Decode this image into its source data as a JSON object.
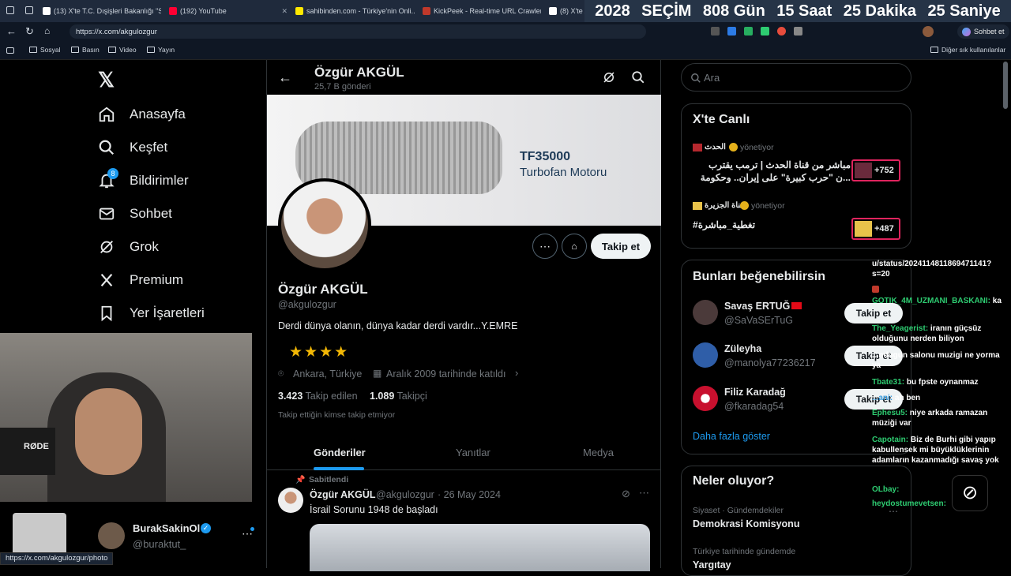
{
  "tabs": [
    {
      "label": "(13) X'te T.C. Dışişleri Bakanlığı \"S...",
      "color": "#fff"
    },
    {
      "label": "(192) YouTube",
      "color": "#ff0033"
    },
    {
      "label": "sahibinden.com - Türkiye'nin Onli...",
      "color": "#ffe800"
    },
    {
      "label": "KickPeek - Real-time URL Crawler...",
      "color": "#c0392b"
    },
    {
      "label": "(8) X'te A...",
      "color": "#fff"
    }
  ],
  "banner": {
    "year": "2028",
    "election": "SEÇİM",
    "days": "808 Gün",
    "hours": "15 Saat",
    "minutes": "25 Dakika",
    "seconds": "25 Saniye"
  },
  "address": {
    "url": "https://x.com/akgulozgur",
    "chat_button": "Sohbet et"
  },
  "bookmarks": {
    "items": [
      "Sosyal",
      "Basın",
      "Video",
      "Yayın"
    ],
    "other": "Diğer sık kullanılanlar"
  },
  "nav": {
    "home": "Anasayfa",
    "explore": "Keşfet",
    "notifications": "Bildirimler",
    "notif_count": "8",
    "messages": "Sohbet",
    "grok": "Grok",
    "premium": "Premium",
    "bookmarks": "Yer İşaretleri"
  },
  "account": {
    "name": "BurakSakinOl",
    "handle": "@buraktut_"
  },
  "status_url": "https://x.com/akgulozgur/photo",
  "profile": {
    "header_name": "Özgür AKGÜL",
    "post_count": "25,7 B gönderi",
    "banner_title": "TF35000",
    "banner_subtitle": "Turbofan Motoru",
    "name": "Özgür AKGÜL",
    "handle": "@akgulozgur",
    "bio": "Derdi dünya olanın, dünya kadar derdi vardır...Y.EMRE",
    "stars": "★★★★",
    "location": "Ankara, Türkiye",
    "joined": "Aralık 2009 tarihinde katıldı",
    "following_count": "3.423",
    "following_label": "Takip edilen",
    "followers_count": "1.089",
    "followers_label": "Takipçi",
    "no_mutual": "Takip ettiğin kimse takip etmiyor",
    "follow_button": "Takip et"
  },
  "tabs_profile": [
    "Gönderiler",
    "Yanıtlar",
    "Medya"
  ],
  "post": {
    "pinned": "Sabitlendi",
    "name": "Özgür AKGÜL",
    "handle": "@akgulozgur",
    "date": "· 26 May 2024",
    "text": "İsrail Sorunu 1948 de başladı"
  },
  "search": {
    "placeholder": "Ara"
  },
  "live": {
    "title": "X'te Canlı",
    "items": [
      {
        "source": "الحدث",
        "role": "yönetiyor",
        "text1": "مباشر من قناة الحدث | ترمب يقترب",
        "text2": "...ن \"حرب كبيرة\" على إيران.. وحكومة",
        "count": "+752"
      },
      {
        "source": "قناة الجزيرة",
        "role": "yönetiyor",
        "text1": "#تغطية_مباشرة",
        "text2": "",
        "count": "+487"
      }
    ]
  },
  "suggest": {
    "title": "Bunları beğenebilirsin",
    "people": [
      {
        "name": "Savaş ERTUĞ",
        "handle": "@SaVaSErTuG",
        "button": "Takip et"
      },
      {
        "name": "Züleyha",
        "handle": "@manolya77236217",
        "button": "Takip et"
      },
      {
        "name": "Filiz Karadağ",
        "handle": "@fkaradag54",
        "button": "Takip et"
      }
    ],
    "more": "Daha fazla göster"
  },
  "trends": {
    "title": "Neler oluyor?",
    "items": [
      {
        "meta": "Siyaset · Gündemdekiler",
        "topic": "Demokrasi Komisyonu"
      },
      {
        "meta": "Türkiye tarihinde gündemde",
        "topic": "Yargıtay"
      }
    ]
  },
  "chat": [
    {
      "user": "",
      "text": "u/status/2024114811869471141?s=20",
      "color": "#fff"
    },
    {
      "user": "GOTIK_4M_UZMANI_BASKANI:",
      "text": " ka",
      "color": "#2ecc71"
    },
    {
      "user": "The_Yeagerist:",
      "text": " iranın güçsüz olduğunu nerden biliyon",
      "color": "#2ecc71"
    },
    {
      "user": "",
      "text": "...ndugun salonu muzigi ne yorma ya",
      "color": "#fff"
    },
    {
      "user": "Tbate31:",
      "text": " bu fpste oynanmaz",
      "color": "#2ecc71"
    },
    {
      "user": "...ani:",
      "text": " ah ben",
      "color": "#3498db"
    },
    {
      "user": "Ephesu5:",
      "text": " niye arkada ramazan müziği var",
      "color": "#2ecc71"
    },
    {
      "user": "Capotain:",
      "text": " Biz de Burhi gibi yapıp kabullensek mi büyüklüklerinin adamların kazanmadığı savaş yok",
      "color": "#2ecc71"
    },
    {
      "user": "OLbay:",
      "text": "",
      "color": "#2ecc71"
    },
    {
      "user": "heydostumevetsen:",
      "text": "",
      "color": "#2ecc71"
    }
  ],
  "webcam": {
    "mic_brand": "RØDE"
  }
}
